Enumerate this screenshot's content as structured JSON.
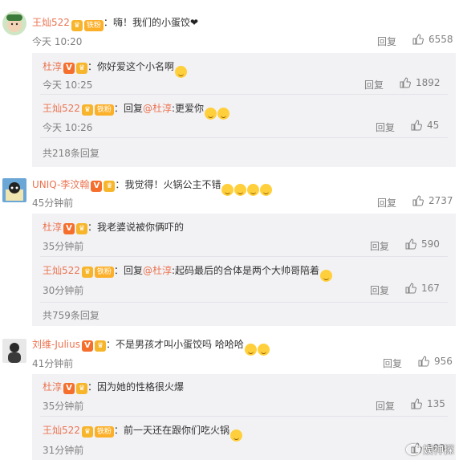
{
  "ui": {
    "reply_label": "回复",
    "fan_badge": "铁粉",
    "reply_prefix": "回复"
  },
  "threads": [
    {
      "user": "王灿522",
      "text": "嗨！我们的小蛋饺",
      "suffix": "❤",
      "time": "今天 10:20",
      "likes": "6558",
      "replies": [
        {
          "user": "杜淳",
          "text": "你好爱这个小名啊",
          "time": "今天 10:25",
          "likes": "1892"
        },
        {
          "user": "王灿522",
          "mention": "@杜淳",
          "text": ":更爱你",
          "time": "今天 10:26",
          "likes": "45"
        }
      ],
      "more": "共218条回复"
    },
    {
      "user": "UNIQ-李汶翰",
      "text": "我觉得！火锅公主不错",
      "time": "45分钟前",
      "likes": "2737",
      "replies": [
        {
          "user": "杜淳",
          "text": "我老婆说被你俩吓的",
          "time": "35分钟前",
          "likes": "590"
        },
        {
          "user": "王灿522",
          "mention": "@杜淳",
          "text": ":起码最后的合体是两个大帅哥陪着",
          "time": "30分钟前",
          "likes": "167"
        }
      ],
      "more": "共759条回复"
    },
    {
      "user": "刘维-Julius",
      "text": "不是男孩才叫小蛋饺吗 哈哈哈",
      "time": "41分钟前",
      "likes": "956",
      "replies": [
        {
          "user": "杜淳",
          "text": "因为她的性格很火爆",
          "time": "35分钟前",
          "likes": "135"
        },
        {
          "user": "王灿522",
          "text": "前一天还在跟你们吃火锅",
          "time": "31分钟前",
          "likes": "103"
        }
      ]
    }
  ],
  "watermark": "娱神探",
  "colors": {
    "username": "#eb7350",
    "meta": "#808080",
    "subbg": "#f2f2f5",
    "vbadge": "#f56e2c",
    "fanbadge": "#fcb02a"
  }
}
